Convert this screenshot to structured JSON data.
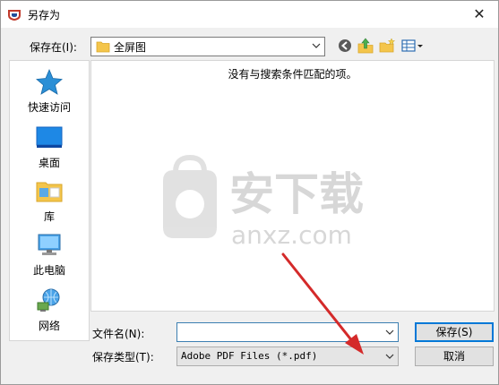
{
  "window": {
    "title": "另存为",
    "close_glyph": "✕"
  },
  "lookin": {
    "label": "保存在(I):",
    "value": "全屏图"
  },
  "places": [
    {
      "label": "快速访问",
      "icon": "star-icon"
    },
    {
      "label": "桌面",
      "icon": "desktop-icon"
    },
    {
      "label": "库",
      "icon": "library-icon"
    },
    {
      "label": "此电脑",
      "icon": "computer-icon"
    },
    {
      "label": "网络",
      "icon": "network-icon"
    }
  ],
  "filelist": {
    "empty_message": "没有与搜索条件匹配的项。"
  },
  "watermark": {
    "text": "安下载",
    "subtext": "anxz.com"
  },
  "filename": {
    "label": "文件名(N):",
    "value": ""
  },
  "filetype": {
    "label": "保存类型(T):",
    "value": "Adobe PDF Files (*.pdf)"
  },
  "buttons": {
    "save": "保存(S)",
    "cancel": "取消"
  },
  "colors": {
    "arrow": "#d42a2a",
    "accent": "#0078d7"
  }
}
